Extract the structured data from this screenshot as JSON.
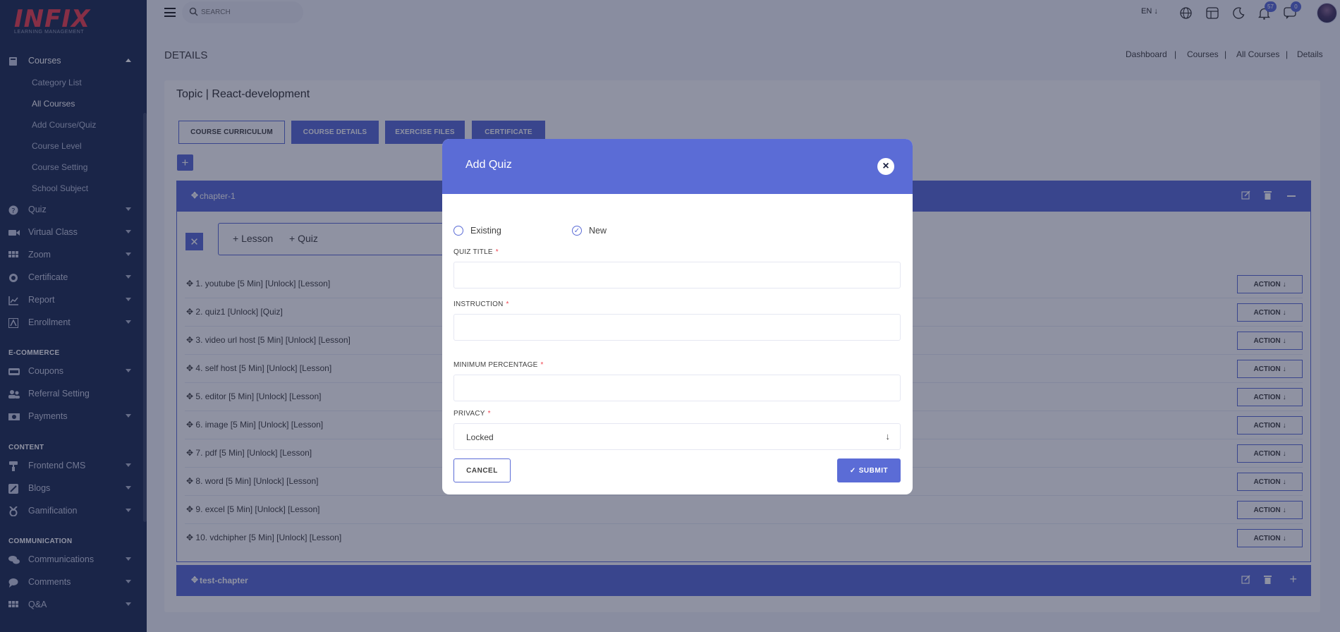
{
  "brand": {
    "logo_text": "INFIX",
    "logo_sub": "LEARNING MANAGEMENT"
  },
  "sidebar": {
    "courses": {
      "label": "Courses",
      "items": [
        "Category List",
        "All Courses",
        "Add Course/Quiz",
        "Course Level",
        "Course Setting",
        "School Subject"
      ],
      "active": "All Courses"
    },
    "menu": [
      {
        "label": "Quiz",
        "icon": "question-circle-icon"
      },
      {
        "label": "Virtual Class",
        "icon": "video-icon"
      },
      {
        "label": "Zoom",
        "icon": "grid-icon"
      },
      {
        "label": "Certificate",
        "icon": "certificate-icon"
      },
      {
        "label": "Report",
        "icon": "chart-icon"
      },
      {
        "label": "Enrollment",
        "icon": "enrollment-icon"
      }
    ],
    "section_ecommerce": "E-COMMERCE",
    "ecommerce": [
      {
        "label": "Coupons",
        "icon": "coupon-icon"
      },
      {
        "label": "Referral Setting",
        "icon": "referral-icon"
      },
      {
        "label": "Payments",
        "icon": "payment-icon"
      }
    ],
    "section_content": "CONTENT",
    "content": [
      {
        "label": "Frontend CMS",
        "icon": "paint-roller-icon"
      },
      {
        "label": "Blogs",
        "icon": "blog-icon"
      },
      {
        "label": "Gamification",
        "icon": "medal-icon"
      }
    ],
    "section_communication": "COMMUNICATION",
    "communication": [
      {
        "label": "Communications",
        "icon": "chat-icon"
      },
      {
        "label": "Comments",
        "icon": "comment-icon"
      },
      {
        "label": "Q&A",
        "icon": "qa-icon"
      }
    ]
  },
  "header": {
    "search_placeholder": "SEARCH",
    "language": "EN",
    "notifications_count": "57",
    "messages_count": "0"
  },
  "page": {
    "title": "DETAILS",
    "breadcrumbs": [
      "Dashboard",
      "Courses",
      "All Courses",
      "Details"
    ],
    "topic": "Topic | React-development",
    "tabs": [
      "COURSE CURRICULUM",
      "COURSE DETAILS",
      "EXERCISE FILES",
      "CERTIFICATE"
    ],
    "chapter1": "chapter-1",
    "add_lesson": "Lesson",
    "add_quiz": "Quiz",
    "lessons": [
      "1. youtube [5 Min] [Unlock] [Lesson]",
      "2. quiz1 [Unlock] [Quiz]",
      "3. video url host [5 Min] [Unlock] [Lesson]",
      "4. self host [5 Min] [Unlock] [Lesson]",
      "5. editor [5 Min] [Unlock] [Lesson]",
      "6. image [5 Min] [Unlock] [Lesson]",
      "7. pdf [5 Min] [Unlock] [Lesson]",
      "8. word [5 Min] [Unlock] [Lesson]",
      "9. excel [5 Min] [Unlock] [Lesson]",
      "10. vdchipher [5 Min] [Unlock] [Lesson]"
    ],
    "action_label": "ACTION",
    "chapter2": "test-chapter"
  },
  "modal": {
    "title": "Add Quiz",
    "option_existing": "Existing",
    "option_new": "New",
    "selected": "New",
    "quiz_title_label": "QUIZ TITLE",
    "quiz_title_value": "",
    "instruction_label": "INSTRUCTION",
    "instruction_value": "",
    "min_percentage_label": "MINIMUM PERCENTAGE",
    "min_percentage_value": "",
    "privacy_label": "PRIVACY",
    "privacy_value": "Locked",
    "required_mark": "*",
    "cancel_label": "CANCEL",
    "submit_label": "SUBMIT"
  },
  "colors": {
    "sidebar": "#202e53",
    "primary": "#5b6cd6",
    "logo": "#f0424f",
    "background": "#f4f5fb"
  }
}
